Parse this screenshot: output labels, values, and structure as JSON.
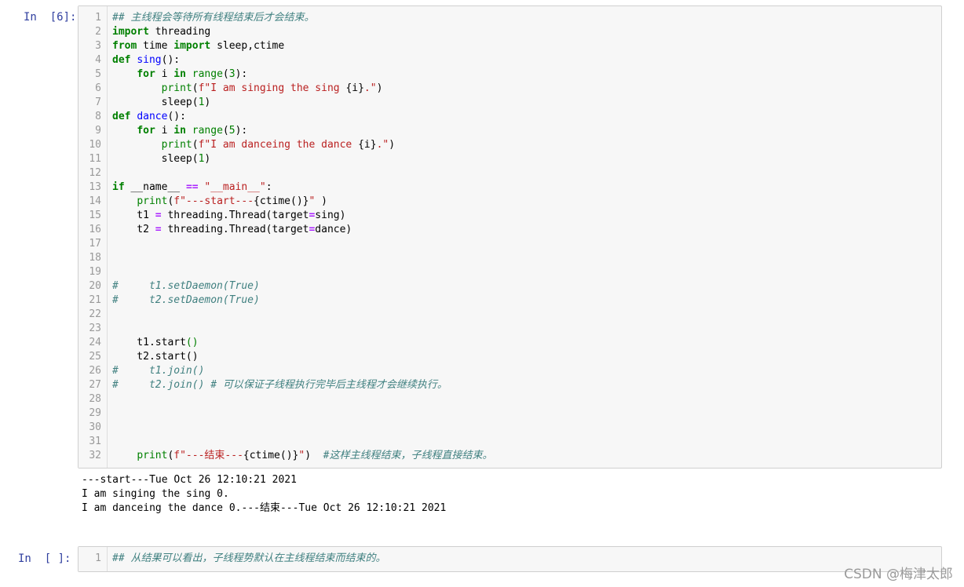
{
  "cell1": {
    "prompt": "In  [6]:",
    "lines": [
      {
        "n": "1",
        "parts": [
          {
            "c": "cm",
            "t": "## 主线程会等待所有线程结束后才会结束。"
          }
        ]
      },
      {
        "n": "2",
        "parts": [
          {
            "c": "kw",
            "t": "import"
          },
          {
            "c": "",
            "t": " threading"
          }
        ]
      },
      {
        "n": "3",
        "parts": [
          {
            "c": "kw",
            "t": "from"
          },
          {
            "c": "",
            "t": " time "
          },
          {
            "c": "kw",
            "t": "import"
          },
          {
            "c": "",
            "t": " sleep,ctime"
          }
        ]
      },
      {
        "n": "4",
        "parts": [
          {
            "c": "kw",
            "t": "def"
          },
          {
            "c": "",
            "t": " "
          },
          {
            "c": "fn",
            "t": "sing"
          },
          {
            "c": "",
            "t": "():"
          }
        ]
      },
      {
        "n": "5",
        "parts": [
          {
            "c": "",
            "t": "    "
          },
          {
            "c": "kw",
            "t": "for"
          },
          {
            "c": "",
            "t": " i "
          },
          {
            "c": "kw",
            "t": "in"
          },
          {
            "c": "",
            "t": " "
          },
          {
            "c": "bi",
            "t": "range"
          },
          {
            "c": "",
            "t": "("
          },
          {
            "c": "nm",
            "t": "3"
          },
          {
            "c": "",
            "t": "):"
          }
        ]
      },
      {
        "n": "6",
        "parts": [
          {
            "c": "",
            "t": "        "
          },
          {
            "c": "bi",
            "t": "print"
          },
          {
            "c": "",
            "t": "("
          },
          {
            "c": "st",
            "t": "f\"I am singing the sing "
          },
          {
            "c": "",
            "t": "{i}"
          },
          {
            "c": "st",
            "t": ".\""
          },
          {
            "c": "",
            "t": ")"
          }
        ]
      },
      {
        "n": "7",
        "parts": [
          {
            "c": "",
            "t": "        sleep("
          },
          {
            "c": "nm",
            "t": "1"
          },
          {
            "c": "",
            "t": ")"
          }
        ]
      },
      {
        "n": "8",
        "parts": [
          {
            "c": "kw",
            "t": "def"
          },
          {
            "c": "",
            "t": " "
          },
          {
            "c": "fn",
            "t": "dance"
          },
          {
            "c": "",
            "t": "():"
          }
        ]
      },
      {
        "n": "9",
        "parts": [
          {
            "c": "",
            "t": "    "
          },
          {
            "c": "kw",
            "t": "for"
          },
          {
            "c": "",
            "t": " i "
          },
          {
            "c": "kw",
            "t": "in"
          },
          {
            "c": "",
            "t": " "
          },
          {
            "c": "bi",
            "t": "range"
          },
          {
            "c": "",
            "t": "("
          },
          {
            "c": "nm",
            "t": "5"
          },
          {
            "c": "",
            "t": "):"
          }
        ]
      },
      {
        "n": "10",
        "parts": [
          {
            "c": "",
            "t": "        "
          },
          {
            "c": "bi",
            "t": "print"
          },
          {
            "c": "",
            "t": "("
          },
          {
            "c": "st",
            "t": "f\"I am danceing the dance "
          },
          {
            "c": "",
            "t": "{i}"
          },
          {
            "c": "st",
            "t": ".\""
          },
          {
            "c": "",
            "t": ")"
          }
        ]
      },
      {
        "n": "11",
        "parts": [
          {
            "c": "",
            "t": "        sleep("
          },
          {
            "c": "nm",
            "t": "1"
          },
          {
            "c": "",
            "t": ")"
          }
        ]
      },
      {
        "n": "12",
        "parts": []
      },
      {
        "n": "13",
        "parts": [
          {
            "c": "kw",
            "t": "if"
          },
          {
            "c": "",
            "t": " __name__ "
          },
          {
            "c": "op",
            "t": "=="
          },
          {
            "c": "",
            "t": " "
          },
          {
            "c": "st",
            "t": "\"__main__\""
          },
          {
            "c": "",
            "t": ":"
          }
        ]
      },
      {
        "n": "14",
        "parts": [
          {
            "c": "",
            "t": "    "
          },
          {
            "c": "bi",
            "t": "print"
          },
          {
            "c": "",
            "t": "("
          },
          {
            "c": "st",
            "t": "f\"---start---"
          },
          {
            "c": "",
            "t": "{ctime()}"
          },
          {
            "c": "st",
            "t": "\""
          },
          {
            "c": "",
            "t": " )"
          }
        ]
      },
      {
        "n": "15",
        "parts": [
          {
            "c": "",
            "t": "    t1 "
          },
          {
            "c": "op",
            "t": "="
          },
          {
            "c": "",
            "t": " threading.Thread(target"
          },
          {
            "c": "op",
            "t": "="
          },
          {
            "c": "",
            "t": "sing)"
          }
        ]
      },
      {
        "n": "16",
        "parts": [
          {
            "c": "",
            "t": "    t2 "
          },
          {
            "c": "op",
            "t": "="
          },
          {
            "c": "",
            "t": " threading.Thread(target"
          },
          {
            "c": "op",
            "t": "="
          },
          {
            "c": "",
            "t": "dance)"
          }
        ]
      },
      {
        "n": "17",
        "parts": []
      },
      {
        "n": "18",
        "parts": []
      },
      {
        "n": "19",
        "parts": []
      },
      {
        "n": "20",
        "parts": [
          {
            "c": "cm",
            "t": "#     t1.setDaemon(True)"
          }
        ]
      },
      {
        "n": "21",
        "parts": [
          {
            "c": "cm",
            "t": "#     t2.setDaemon(True)"
          }
        ]
      },
      {
        "n": "22",
        "parts": []
      },
      {
        "n": "23",
        "parts": []
      },
      {
        "n": "24",
        "parts": [
          {
            "c": "",
            "t": "    t1.start"
          },
          {
            "c": "bi",
            "t": "()"
          }
        ]
      },
      {
        "n": "25",
        "parts": [
          {
            "c": "",
            "t": "    t2.start()"
          }
        ]
      },
      {
        "n": "26",
        "parts": [
          {
            "c": "cm",
            "t": "#     t1.join()"
          }
        ]
      },
      {
        "n": "27",
        "parts": [
          {
            "c": "cm",
            "t": "#     t2.join() # 可以保证子线程执行完毕后主线程才会继续执行。"
          }
        ]
      },
      {
        "n": "28",
        "parts": []
      },
      {
        "n": "29",
        "parts": []
      },
      {
        "n": "30",
        "parts": []
      },
      {
        "n": "31",
        "parts": []
      },
      {
        "n": "32",
        "parts": [
          {
            "c": "",
            "t": "    "
          },
          {
            "c": "bi",
            "t": "print"
          },
          {
            "c": "",
            "t": "("
          },
          {
            "c": "st",
            "t": "f\"---结束---"
          },
          {
            "c": "",
            "t": "{ctime()}"
          },
          {
            "c": "st",
            "t": "\""
          },
          {
            "c": "",
            "t": ")  "
          },
          {
            "c": "cm",
            "t": "#这样主线程结束，子线程直接结束。"
          }
        ]
      }
    ],
    "output": [
      "---start---Tue Oct 26 12:10:21 2021",
      "I am singing the sing 0.",
      "I am danceing the dance 0.---结束---Tue Oct 26 12:10:21 2021"
    ]
  },
  "cell2": {
    "prompt": "In  [ ]:",
    "lines": [
      {
        "n": "1",
        "parts": [
          {
            "c": "cm",
            "t": "## 从结果可以看出，子线程势默认在主线程结束而结束的。"
          }
        ]
      }
    ]
  },
  "watermark": "CSDN @梅津太郎"
}
